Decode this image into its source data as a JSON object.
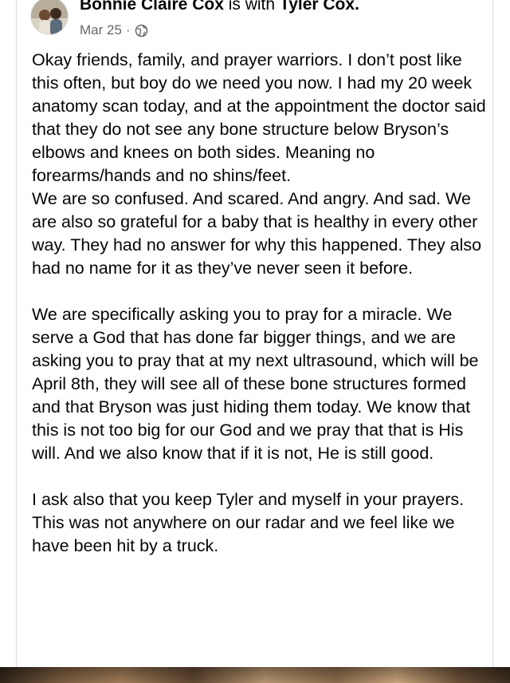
{
  "post": {
    "author": "Bonnie Claire Cox",
    "with_text": "is with",
    "tagged": "Tyler Cox.",
    "date": "Mar 25",
    "separator": "·",
    "audience_icon": "globe-icon",
    "paragraphs": [
      "Okay friends, family, and prayer warriors. I don’t post like this often, but boy do we need you now. I had my 20 week anatomy scan today, and at the appointment the doctor said that they do not see any bone structure below Bryson’s elbows and knees on both sides. Meaning no forearms/hands and no shins/feet.\nWe are so confused. And scared. And angry. And sad. We are also so grateful for a baby that is healthy in every other way. They had no answer for why this happened. They also had no name for it as they’ve never seen it before.",
      "We are specifically asking you to pray for a miracle. We serve a God that has done far bigger things, and we are asking you to pray that at my next ultrasound, which will be April 8th, they will see all of these bone structures formed and that Bryson was just hiding them today. We know that this is not too big for our God and we pray that that is His will. And we also know that if it is not, He is still good.",
      "I ask also that you keep Tyler and myself in your prayers. This was not anywhere on our radar and we feel like we have been hit by a truck."
    ]
  },
  "colors": {
    "text": "#050505",
    "meta": "#65676b",
    "border": "#dadde1"
  }
}
